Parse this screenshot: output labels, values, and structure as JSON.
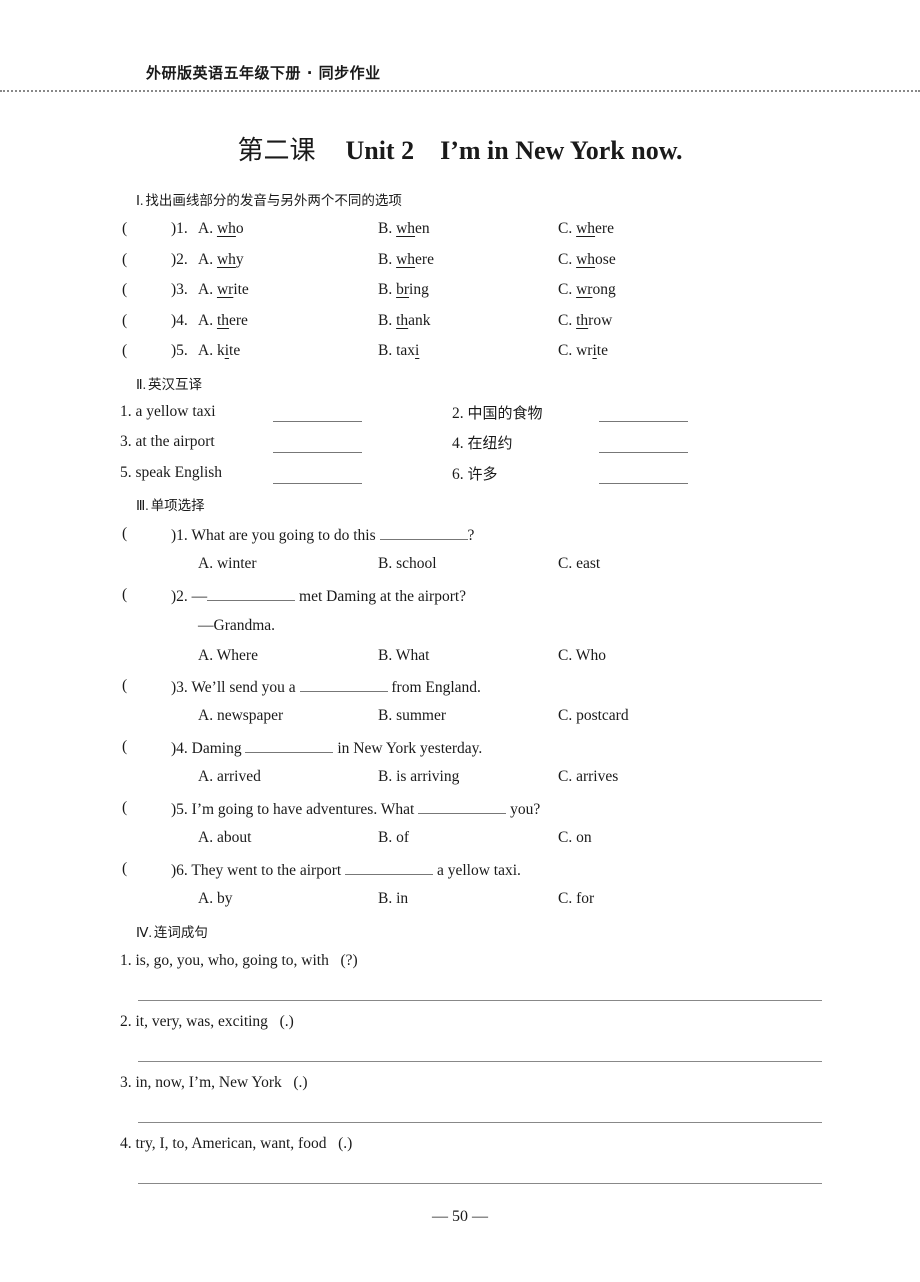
{
  "header": {
    "book_title": "外研版英语五年级下册 · 同步作业"
  },
  "title": {
    "lesson": "第二课",
    "unit": "Unit 2",
    "topic": "I’m in New York now."
  },
  "section1": {
    "number": "Ⅰ.",
    "label": "找出画线部分的发音与另外两个不同的选项",
    "items": [
      {
        "paren": "(",
        "close": ")",
        "num": "1.",
        "a_pre": "A. ",
        "a_u": "wh",
        "a_post": "o",
        "b_pre": "B. ",
        "b_u": "wh",
        "b_post": "en",
        "c_pre": "C. ",
        "c_u": "wh",
        "c_post": "ere"
      },
      {
        "paren": "(",
        "close": ")",
        "num": "2.",
        "a_pre": "A. ",
        "a_u": "wh",
        "a_post": "y",
        "b_pre": "B. ",
        "b_u": "wh",
        "b_post": "ere",
        "c_pre": "C. ",
        "c_u": "wh",
        "c_post": "ose"
      },
      {
        "paren": "(",
        "close": ")",
        "num": "3.",
        "a_pre": "A. ",
        "a_u": "wr",
        "a_post": "ite",
        "b_pre": "B. ",
        "b_u": "br",
        "b_post": "ing",
        "c_pre": "C. ",
        "c_u": "wr",
        "c_post": "ong"
      },
      {
        "paren": "(",
        "close": ")",
        "num": "4.",
        "a_pre": "A. ",
        "a_u": "th",
        "a_post": "ere",
        "b_pre": "B. ",
        "b_u": "th",
        "b_post": "ank",
        "c_pre": "C. ",
        "c_u": "th",
        "c_post": "row"
      },
      {
        "paren": "(",
        "close": ")",
        "num": "5.",
        "a_pre": "A. k",
        "a_u": "i",
        "a_post": "te",
        "b_pre": "B. tax",
        "b_u": "i",
        "b_post": "",
        "c_pre": "C. wr",
        "c_u": "i",
        "c_post": "te"
      }
    ]
  },
  "section2": {
    "number": "Ⅱ.",
    "label": "英汉互译",
    "items": [
      {
        "num": "1.",
        "text": "a yellow taxi"
      },
      {
        "num": "2.",
        "text": "中国的食物"
      },
      {
        "num": "3.",
        "text": "at the airport"
      },
      {
        "num": "4.",
        "text": "在纽约"
      },
      {
        "num": "5.",
        "text": "speak English"
      },
      {
        "num": "6.",
        "text": "许多"
      }
    ]
  },
  "section3": {
    "number": "Ⅲ.",
    "label": "单项选择",
    "items": [
      {
        "paren": "(",
        "close": ")",
        "num": "1.",
        "pre": "What are you going to do this",
        "post": "?",
        "extra": "",
        "a": "A. winter",
        "b": "B. school",
        "c": "C. east"
      },
      {
        "paren": "(",
        "close": ")",
        "num": "2.",
        "pre": "—",
        "post": "met Daming at the airport?",
        "extra": "—Grandma.",
        "a": "A. Where",
        "b": "B. What",
        "c": "C. Who"
      },
      {
        "paren": "(",
        "close": ")",
        "num": "3.",
        "pre": "We’ll send you a",
        "post": "from England.",
        "extra": "",
        "a": "A. newspaper",
        "b": "B. summer",
        "c": "C. postcard"
      },
      {
        "paren": "(",
        "close": ")",
        "num": "4.",
        "pre": "Daming",
        "post": "in New York yesterday.",
        "extra": "",
        "a": "A. arrived",
        "b": "B. is arriving",
        "c": "C. arrives"
      },
      {
        "paren": "(",
        "close": ")",
        "num": "5.",
        "pre": "I’m going to have adventures. What",
        "post": "you?",
        "extra": "",
        "a": "A. about",
        "b": "B. of",
        "c": "C. on"
      },
      {
        "paren": "(",
        "close": ")",
        "num": "6.",
        "pre": "They went to the airport",
        "post": "a yellow taxi.",
        "extra": "",
        "a": "A. by",
        "b": "B. in",
        "c": "C. for"
      }
    ]
  },
  "section4": {
    "number": "Ⅳ.",
    "label": "连词成句",
    "items": [
      {
        "num": "1.",
        "words": "is, go, you, who, going to, with",
        "punct": "(?)"
      },
      {
        "num": "2.",
        "words": "it, very, was, exciting",
        "punct": "(.)"
      },
      {
        "num": "3.",
        "words": "in, now, I’m, New York",
        "punct": "(.)"
      },
      {
        "num": "4.",
        "words": "try, I, to, American, want, food",
        "punct": "(.)"
      }
    ]
  },
  "footer": {
    "page_number": "— 50 —"
  }
}
